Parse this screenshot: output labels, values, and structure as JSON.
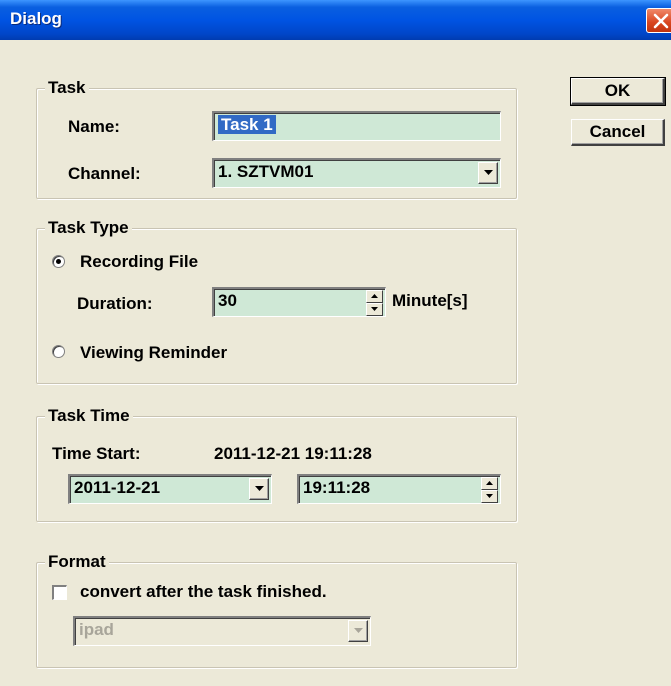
{
  "window": {
    "title": "Dialog"
  },
  "buttons": {
    "ok": "OK",
    "cancel": "Cancel"
  },
  "task": {
    "legend": "Task",
    "name_label": "Name:",
    "name_value": "Task 1",
    "channel_label": "Channel:",
    "channel_value": "1. SZTVM01"
  },
  "task_type": {
    "legend": "Task Type",
    "recording_label": "Recording File",
    "recording_selected": true,
    "duration_label": "Duration:",
    "duration_value": "30",
    "duration_unit": "Minute[s]",
    "viewing_label": "Viewing Reminder",
    "viewing_selected": false
  },
  "task_time": {
    "legend": "Task Time",
    "start_label": "Time Start:",
    "start_value": "2011-12-21 19:11:28",
    "date_value": "2011-12-21",
    "time_value": "19:11:28"
  },
  "format": {
    "legend": "Format",
    "convert_label": "convert after the task finished.",
    "convert_checked": false,
    "format_value": "ipad"
  },
  "colors": {
    "field_bg": "#cfe8d6",
    "dialog_bg": "#ece9d8",
    "title_bar": "#0054e3",
    "selection": "#316ac5"
  }
}
